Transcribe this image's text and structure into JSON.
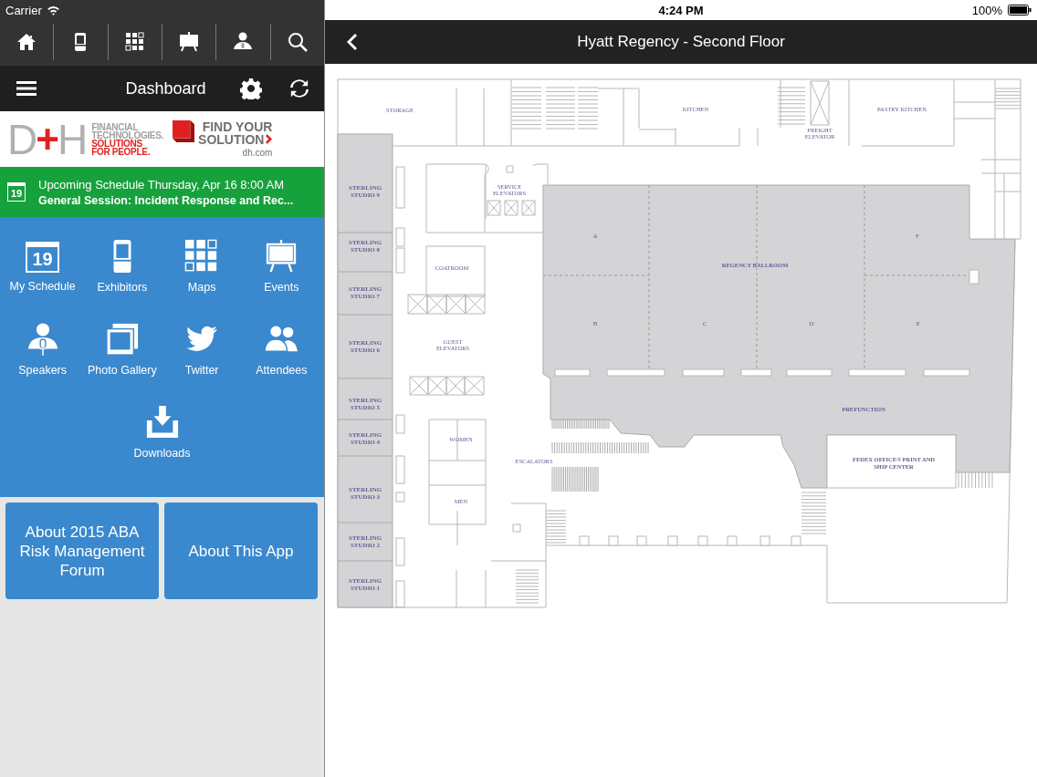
{
  "status_bar": {
    "carrier": "Carrier",
    "time": "4:24 PM",
    "battery": "100%"
  },
  "sidebar": {
    "title": "Dashboard",
    "ad": {
      "logo": {
        "left": "D",
        "mark": "+",
        "right": "H"
      },
      "tagline": [
        "FINANCIAL",
        "TECHNOLOGIES."
      ],
      "slogan": [
        "SOLUTIONS",
        "FOR PEOPLE."
      ],
      "cta": [
        "FIND YOUR",
        "SOLUTION"
      ],
      "url": "dh.com"
    },
    "upcoming": {
      "date_badge": "19",
      "heading": "Upcoming Schedule Thursday, Apr 16 8:00 AM",
      "session": "General Session: Incident Response and Rec..."
    },
    "tiles": [
      {
        "label": "My Schedule",
        "kind": "calendar",
        "badge": "19"
      },
      {
        "label": "Exhibitors",
        "kind": "kiosk"
      },
      {
        "label": "Maps",
        "kind": "grid"
      },
      {
        "label": "Events",
        "kind": "easel"
      },
      {
        "label": "Speakers",
        "kind": "speaker"
      },
      {
        "label": "Photo Gallery",
        "kind": "photos"
      },
      {
        "label": "Twitter",
        "kind": "bird"
      },
      {
        "label": "Attendees",
        "kind": "people"
      },
      {
        "label": "Downloads",
        "kind": "download"
      }
    ],
    "buttons": [
      "About 2015 ABA Risk Management Forum",
      "About This App"
    ]
  },
  "map": {
    "title": "Hyatt Regency - Second Floor",
    "rooms": [
      "STORAGE",
      "KITCHEN",
      "FREIGHT ELEVATOR",
      "PASTRY KITCHEN",
      "STERLING STUDIO 9",
      "SERVICE ELEVATORS",
      "A",
      "REGENCY BALLROOM",
      "F",
      "STERLING STUDIO 8",
      "COATROOM",
      "STERLING STUDIO 7",
      "B",
      "C",
      "D",
      "E",
      "STERLING STUDIO 6",
      "GUEST ELEVATORS",
      "STERLING STUDIO 5",
      "PREFUNCTION",
      "WOMEN",
      "STERLING STUDIO 4",
      "ESCALATORS",
      "FEDEX OFFICE® PRINT AND SHIP CENTER",
      "STERLING STUDIO 3",
      "MEN",
      "STERLING STUDIO 2",
      "STERLING STUDIO 1"
    ]
  }
}
